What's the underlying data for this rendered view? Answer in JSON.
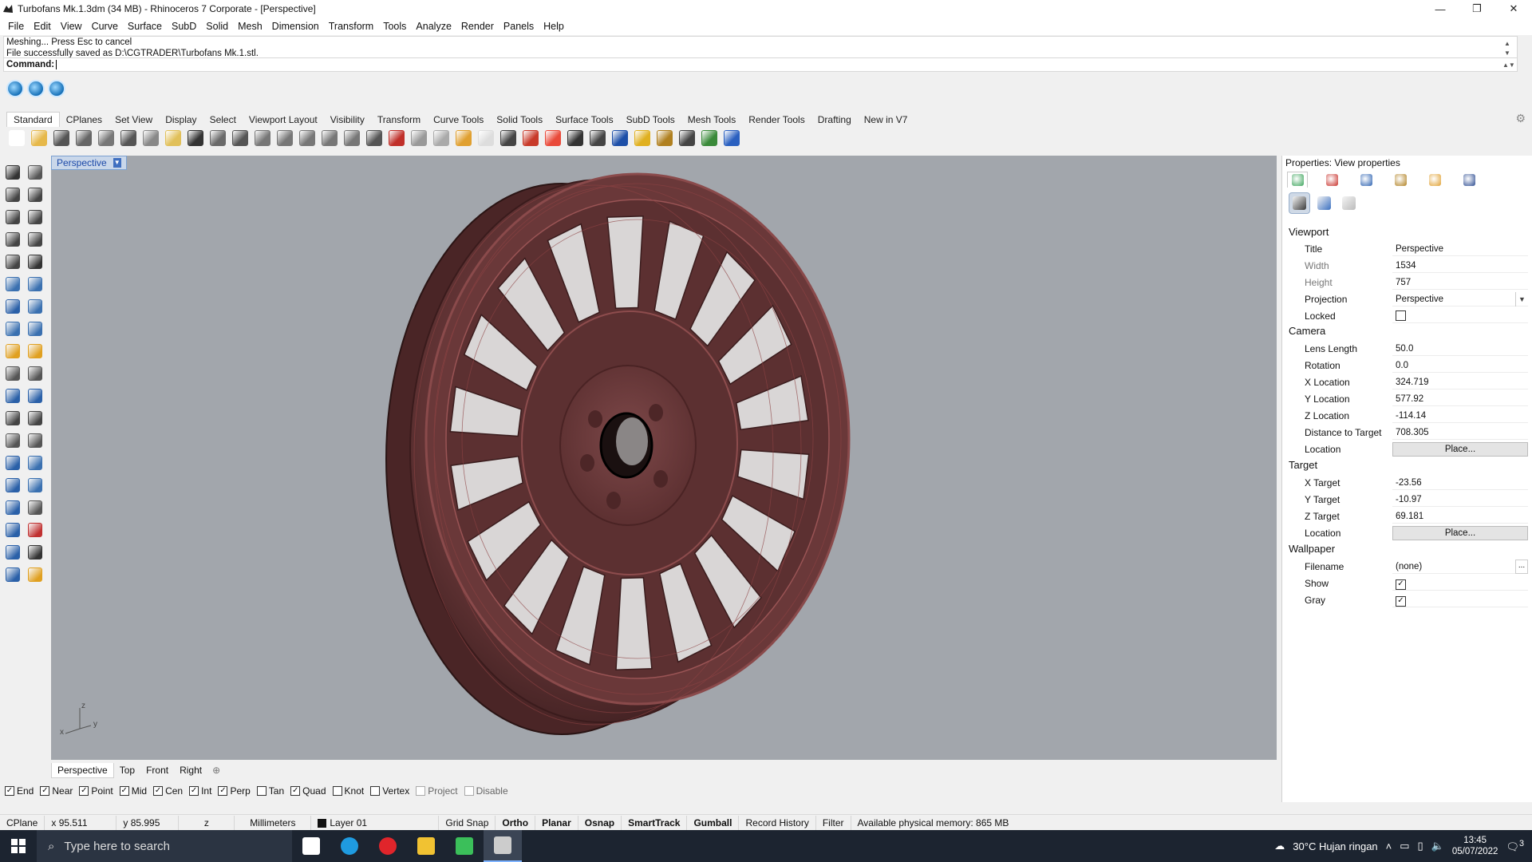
{
  "window": {
    "title": "Turbofans Mk.1.3dm (34 MB) - Rhinoceros 7 Corporate - [Perspective]",
    "controls": [
      "—",
      "❐",
      "✕"
    ]
  },
  "menu": [
    "File",
    "Edit",
    "View",
    "Curve",
    "Surface",
    "SubD",
    "Solid",
    "Mesh",
    "Dimension",
    "Transform",
    "Tools",
    "Analyze",
    "Render",
    "Panels",
    "Help"
  ],
  "command": {
    "history": [
      "Meshing... Press Esc to cancel",
      "File successfully saved as D:\\CGTRADER\\Turbofans Mk.1.stl."
    ],
    "prompt": "Command:",
    "value": ""
  },
  "toolbar_tabs": [
    "Standard",
    "CPlanes",
    "Set View",
    "Display",
    "Select",
    "Viewport Layout",
    "Visibility",
    "Transform",
    "Curve Tools",
    "Solid Tools",
    "Surface Tools",
    "SubD Tools",
    "Mesh Tools",
    "Render Tools",
    "Drafting",
    "New in V7"
  ],
  "toolbar_icons": [
    {
      "name": "new-file-icon",
      "color": "#ffffff"
    },
    {
      "name": "open-folder-icon",
      "color": "#e6b84a"
    },
    {
      "name": "save-icon",
      "color": "#555555"
    },
    {
      "name": "print-icon",
      "color": "#666666"
    },
    {
      "name": "import-icon",
      "color": "#777777"
    },
    {
      "name": "cut-icon",
      "color": "#555555"
    },
    {
      "name": "copy-icon",
      "color": "#888888"
    },
    {
      "name": "paste-icon",
      "color": "#e1c05a"
    },
    {
      "name": "undo-icon",
      "color": "#333333"
    },
    {
      "name": "pan-icon",
      "color": "#6a6a6a"
    },
    {
      "name": "rotate-view-icon",
      "color": "#555555"
    },
    {
      "name": "zoom-icon",
      "color": "#777777"
    },
    {
      "name": "zoom-window-icon",
      "color": "#777777"
    },
    {
      "name": "zoom-extents-icon",
      "color": "#777777"
    },
    {
      "name": "zoom-selected-icon",
      "color": "#777777"
    },
    {
      "name": "zoom-all-icon",
      "color": "#777777"
    },
    {
      "name": "four-viewports-icon",
      "color": "#555555"
    },
    {
      "name": "car-icon",
      "color": "#c0302a"
    },
    {
      "name": "named-view-icon",
      "color": "#999999"
    },
    {
      "name": "cplane-icon",
      "color": "#aaaaaa"
    },
    {
      "name": "select-filter-icon",
      "color": "#e0a030"
    },
    {
      "name": "light-bulb-icon",
      "color": "#dddddd"
    },
    {
      "name": "lock-icon",
      "color": "#444444"
    },
    {
      "name": "layer-icon",
      "color": "#c83a2a"
    },
    {
      "name": "color-wheel-icon",
      "color": "#e94a3a"
    },
    {
      "name": "shaded-sphere-icon",
      "color": "#333333"
    },
    {
      "name": "rendered-sphere-icon",
      "color": "#444444"
    },
    {
      "name": "render-icon",
      "color": "#1d4fa8"
    },
    {
      "name": "analyze-icon",
      "color": "#e0b020"
    },
    {
      "name": "gear-settings-icon",
      "color": "#b08020"
    },
    {
      "name": "dimension-icon",
      "color": "#444444"
    },
    {
      "name": "globe-icon",
      "color": "#3a8a3a"
    },
    {
      "name": "help-icon",
      "color": "#2a60c0"
    }
  ],
  "left_toolbar": [
    {
      "name": "select-arrow-icon",
      "color": "#333333"
    },
    {
      "name": "point-icon",
      "color": "#555555"
    },
    {
      "name": "polyline-icon",
      "color": "#444444"
    },
    {
      "name": "curve-icon",
      "color": "#444444"
    },
    {
      "name": "circle-icon",
      "color": "#444444"
    },
    {
      "name": "arc-icon",
      "color": "#444444"
    },
    {
      "name": "polygon-icon",
      "color": "#444444"
    },
    {
      "name": "rectangle-icon",
      "color": "#444444"
    },
    {
      "name": "ellipse-icon",
      "color": "#444444"
    },
    {
      "name": "freeform-icon",
      "color": "#333333"
    },
    {
      "name": "surface-icon",
      "color": "#3a70b0"
    },
    {
      "name": "loft-icon",
      "color": "#3a70b0"
    },
    {
      "name": "box-icon",
      "color": "#2a60a8"
    },
    {
      "name": "extrude-icon",
      "color": "#3a70b0"
    },
    {
      "name": "cylinder-icon",
      "color": "#3a70b0"
    },
    {
      "name": "mesh-icon",
      "color": "#3a70b0"
    },
    {
      "name": "explode-icon",
      "color": "#e0a020"
    },
    {
      "name": "trim-icon",
      "color": "#e0a020"
    },
    {
      "name": "split-icon",
      "color": "#555555"
    },
    {
      "name": "join-icon",
      "color": "#555555"
    },
    {
      "name": "boolean-icon",
      "color": "#2a60a8"
    },
    {
      "name": "group-icon",
      "color": "#2a60a8"
    },
    {
      "name": "fillet-icon",
      "color": "#444444"
    },
    {
      "name": "offset-icon",
      "color": "#444444"
    },
    {
      "name": "move-icon",
      "color": "#555555"
    },
    {
      "name": "scale-icon",
      "color": "#555555"
    },
    {
      "name": "text-icon",
      "color": "#2a60a8"
    },
    {
      "name": "copy-tool-icon",
      "color": "#3a70b0"
    },
    {
      "name": "array-icon",
      "color": "#2a60a8"
    },
    {
      "name": "align-icon",
      "color": "#3a70b0"
    },
    {
      "name": "dimension-tool-icon",
      "color": "#2a60a8"
    },
    {
      "name": "ruler-icon",
      "color": "#555555"
    },
    {
      "name": "point-grid-icon",
      "color": "#2a60a8"
    },
    {
      "name": "text-object-icon",
      "color": "#c03030"
    },
    {
      "name": "block-icon",
      "color": "#2a60a8"
    },
    {
      "name": "check-icon",
      "color": "#333333"
    },
    {
      "name": "analysis-icon",
      "color": "#2a60a8"
    },
    {
      "name": "render-tool-icon",
      "color": "#e0a020"
    }
  ],
  "viewport": {
    "title": "Perspective",
    "axis_labels": {
      "x": "x",
      "y": "y",
      "z": "z"
    },
    "tabs": [
      "Perspective",
      "Top",
      "Front",
      "Right"
    ],
    "add_tab": "⊕",
    "background_color": "#a2a6ac",
    "model_color": "#6e3b3c"
  },
  "osnaps": [
    {
      "label": "End",
      "checked": true,
      "enabled": true
    },
    {
      "label": "Near",
      "checked": true,
      "enabled": true
    },
    {
      "label": "Point",
      "checked": true,
      "enabled": true
    },
    {
      "label": "Mid",
      "checked": true,
      "enabled": true
    },
    {
      "label": "Cen",
      "checked": true,
      "enabled": true
    },
    {
      "label": "Int",
      "checked": true,
      "enabled": true
    },
    {
      "label": "Perp",
      "checked": true,
      "enabled": true
    },
    {
      "label": "Tan",
      "checked": false,
      "enabled": true
    },
    {
      "label": "Quad",
      "checked": true,
      "enabled": true
    },
    {
      "label": "Knot",
      "checked": false,
      "enabled": true
    },
    {
      "label": "Vertex",
      "checked": false,
      "enabled": true
    },
    {
      "label": "Project",
      "checked": false,
      "enabled": false
    },
    {
      "label": "Disable",
      "checked": false,
      "enabled": false
    }
  ],
  "statusbar": {
    "cplane": "CPlane",
    "x": "x 95.511",
    "y": "y 85.995",
    "z": "z",
    "units": "Millimeters",
    "layer": "Layer 01",
    "toggles": [
      {
        "label": "Grid Snap",
        "bold": false
      },
      {
        "label": "Ortho",
        "bold": true
      },
      {
        "label": "Planar",
        "bold": true
      },
      {
        "label": "Osnap",
        "bold": true
      },
      {
        "label": "SmartTrack",
        "bold": true
      },
      {
        "label": "Gumball",
        "bold": true
      },
      {
        "label": "Record History",
        "bold": false
      },
      {
        "label": "Filter",
        "bold": false
      }
    ],
    "memory": "Available physical memory: 865 MB"
  },
  "properties": {
    "title": "Properties: View properties",
    "tab_icons": [
      "object-properties-icon",
      "material-icon",
      "environment-icon",
      "pen-icon",
      "folder-icon",
      "image-icon"
    ],
    "subtab_icons": [
      "camera-view-icon",
      "rendering-brush-icon",
      "display-monitor-icon"
    ],
    "sections": {
      "viewport": {
        "label": "Viewport"
      },
      "camera": {
        "label": "Camera"
      },
      "target": {
        "label": "Target"
      },
      "wallpaper": {
        "label": "Wallpaper"
      }
    },
    "rows": {
      "title": {
        "label": "Title",
        "value": "Perspective"
      },
      "width": {
        "label": "Width",
        "value": "1534"
      },
      "height": {
        "label": "Height",
        "value": "757"
      },
      "projection": {
        "label": "Projection",
        "value": "Perspective"
      },
      "locked": {
        "label": "Locked",
        "checked": false
      },
      "lens_length": {
        "label": "Lens Length",
        "value": "50.0"
      },
      "rotation": {
        "label": "Rotation",
        "value": "0.0"
      },
      "x_location": {
        "label": "X Location",
        "value": "324.719"
      },
      "y_location": {
        "label": "Y Location",
        "value": "577.92"
      },
      "z_location": {
        "label": "Z Location",
        "value": "-114.14"
      },
      "distance_to_target": {
        "label": "Distance to Target",
        "value": "708.305"
      },
      "camera_location": {
        "label": "Location",
        "button": "Place..."
      },
      "x_target": {
        "label": "X Target",
        "value": "-23.56"
      },
      "y_target": {
        "label": "Y Target",
        "value": "-10.97"
      },
      "z_target": {
        "label": "Z Target",
        "value": "69.181"
      },
      "target_location": {
        "label": "Location",
        "button": "Place..."
      },
      "filename": {
        "label": "Filename",
        "value": "(none)",
        "button": "..."
      },
      "show": {
        "label": "Show",
        "checked": true
      },
      "gray": {
        "label": "Gray",
        "checked": true
      }
    }
  },
  "taskbar": {
    "search_placeholder": "Type here to search",
    "apps": [
      "task-view-icon",
      "edge-browser-icon",
      "opera-browser-icon",
      "file-explorer-icon",
      "vpn-app-icon",
      "rhino-app-icon"
    ],
    "weather": "30°C  Hujan ringan",
    "time": "13:45",
    "date": "05/07/2022",
    "notifications": "3"
  }
}
